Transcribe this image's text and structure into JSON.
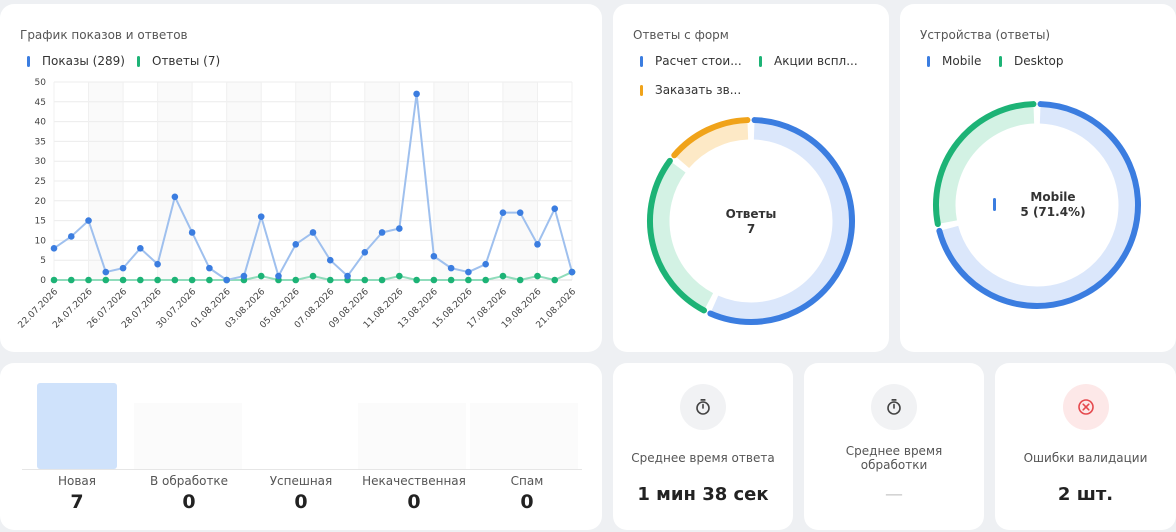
{
  "line_card": {
    "title": "График показов и ответов",
    "legend": [
      {
        "label": "Показы (289)",
        "color": "#3b7de0"
      },
      {
        "label": "Ответы (7)",
        "color": "#1db376"
      }
    ]
  },
  "forms_card": {
    "title": "Ответы с форм",
    "legend": [
      {
        "label": "Расчет стои...",
        "color": "#3b7de0"
      },
      {
        "label": "Акции вспл...",
        "color": "#1db376"
      },
      {
        "label": "Заказать зв...",
        "color": "#f0a31a"
      }
    ],
    "center_title": "Ответы",
    "center_value": "7"
  },
  "devices_card": {
    "title": "Устройства (ответы)",
    "legend": [
      {
        "label": "Mobile",
        "color": "#3b7de0"
      },
      {
        "label": "Desktop",
        "color": "#1db376"
      }
    ],
    "center_title": "Mobile",
    "center_value": "5 (71.4%)"
  },
  "status_card": {
    "statuses": [
      {
        "label": "Новая",
        "count": "7"
      },
      {
        "label": "В обработке",
        "count": "0"
      },
      {
        "label": "Успешная",
        "count": "0"
      },
      {
        "label": "Некачественная",
        "count": "0"
      },
      {
        "label": "Спам",
        "count": "0"
      }
    ]
  },
  "stats": [
    {
      "icon": "stopwatch-icon",
      "label": "Среднее время ответа",
      "value": "1 мин 38 сек"
    },
    {
      "icon": "stopwatch-icon",
      "label": "Среднее время обработки",
      "value": "—"
    },
    {
      "icon": "error-circle-icon",
      "label": "Ошибки валидации",
      "value": "2 шт."
    }
  ],
  "colors": {
    "blue": "#3b7de0",
    "blue_light": "#dbe7fb",
    "green": "#1db376",
    "green_light": "#d3f2e4",
    "orange": "#f0a31a",
    "orange_light": "#fde9c6",
    "error": "#e5484d"
  },
  "chart_data": [
    {
      "type": "line",
      "title": "График показов и ответов",
      "x": [
        "22.07.2026",
        "23.07.2026",
        "24.07.2026",
        "25.07.2026",
        "26.07.2026",
        "27.07.2026",
        "28.07.2026",
        "29.07.2026",
        "30.07.2026",
        "31.07.2026",
        "01.08.2026",
        "02.08.2026",
        "03.08.2026",
        "04.08.2026",
        "05.08.2026",
        "06.08.2026",
        "07.08.2026",
        "08.08.2026",
        "09.08.2026",
        "10.08.2026",
        "11.08.2026",
        "12.08.2026",
        "13.08.2026",
        "14.08.2026",
        "15.08.2026",
        "16.08.2026",
        "17.08.2026",
        "18.08.2026",
        "19.08.2026",
        "20.08.2026",
        "21.08.2026"
      ],
      "tick_labels": [
        "22.07.2026",
        "24.07.2026",
        "26.07.2026",
        "28.07.2026",
        "30.07.2026",
        "01.08.2026",
        "03.08.2026",
        "05.08.2026",
        "07.08.2026",
        "09.08.2026",
        "11.08.2026",
        "13.08.2026",
        "15.08.2026",
        "17.08.2026",
        "19.08.2026",
        "21.08.2026"
      ],
      "series": [
        {
          "name": "Показы (289)",
          "color": "#3b7de0",
          "values": [
            8,
            11,
            15,
            2,
            3,
            8,
            4,
            21,
            12,
            3,
            0,
            1,
            16,
            1,
            9,
            12,
            5,
            1,
            7,
            12,
            13,
            47,
            6,
            3,
            2,
            4,
            17,
            17,
            9,
            18,
            2
          ]
        },
        {
          "name": "Ответы (7)",
          "color": "#1db376",
          "values": [
            0,
            0,
            0,
            0,
            0,
            0,
            0,
            0,
            0,
            0,
            0,
            0,
            1,
            0,
            0,
            1,
            0,
            0,
            0,
            0,
            1,
            0,
            0,
            0,
            0,
            0,
            1,
            0,
            1,
            0,
            2
          ]
        }
      ],
      "yticks": [
        0,
        5,
        10,
        15,
        20,
        25,
        30,
        35,
        40,
        45,
        50
      ],
      "ylim": [
        0,
        50
      ],
      "grid": true
    },
    {
      "type": "pie",
      "title": "Ответы с форм",
      "categories": [
        "Расчет стои...",
        "Акции вспл...",
        "Заказать зв..."
      ],
      "values": [
        4,
        2,
        1
      ],
      "colors": [
        "#3b7de0",
        "#1db376",
        "#f0a31a"
      ]
    },
    {
      "type": "pie",
      "title": "Устройства (ответы)",
      "categories": [
        "Mobile",
        "Desktop"
      ],
      "values": [
        5,
        2
      ],
      "colors": [
        "#3b7de0",
        "#1db376"
      ]
    }
  ]
}
